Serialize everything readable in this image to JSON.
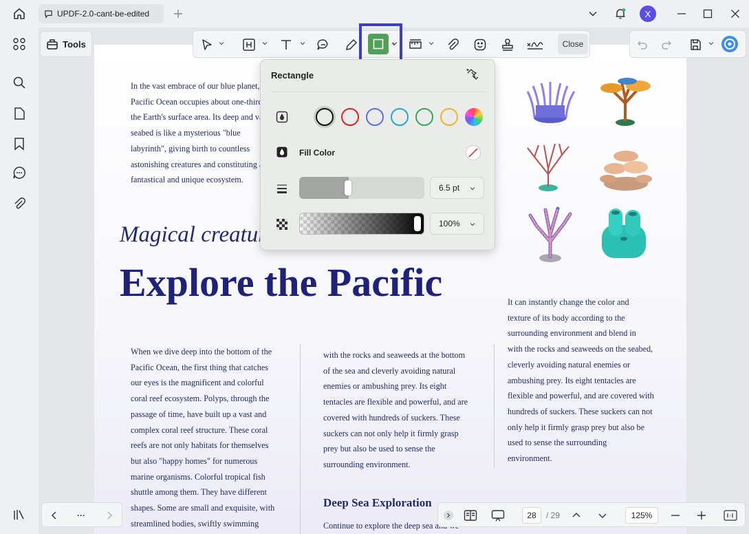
{
  "window": {
    "tab_title": "UPDF-2.0-cant-be-edited",
    "avatar_initial": "X"
  },
  "tools": {
    "label": "Tools"
  },
  "toolbar": {
    "close_label": "Close"
  },
  "popup": {
    "title": "Rectangle",
    "fill_color_label": "Fill Color",
    "stroke_colors": [
      "#111111",
      "#e0211f",
      "#5b6ee8",
      "#1fa7dc",
      "#3aa45a",
      "#f0b429",
      "rainbow"
    ],
    "selected_stroke": "#111111",
    "stroke_width": "6.5 pt",
    "opacity": "100%",
    "stroke_width_fraction": 0.36
  },
  "document": {
    "intro": "In the vast embrace of our blue planet, the\nPacific Ocean occupies about one-third of\nthe Earth's surface area. Its deep and vast\nseabed is like a mysterious \"blue\nlabyrinth\", giving birth to countless\nastonishing creatures and constituting a\nfantastical and unique ecosystem.",
    "subtitle": "Magical creatures",
    "title": "Explore the Pacific",
    "col1": "When we dive deep into the bottom of the\nPacific Ocean, the first thing that catches\nour eyes is the magnificent and colorful\ncoral reef ecosystem. Polyps, through the\npassage of time, have built up a vast and\ncomplex coral reef structure. These coral\nreefs are not only habitats for themselves\nbut also \"happy homes\" for numerous\nmarine organisms. Colorful tropical fish\nshuttle among them. They have different\nshapes. Some are small and exquisite, with\nstreamlined bodies, swiftly swimming",
    "col2": "with the rocks and seaweeds at the bottom\nof the sea and cleverly avoiding natural\nenemies or ambushing prey. Its eight\ntentacles are flexible and powerful, and are\ncovered with hundreds of suckers. These\nsuckers can not only help it firmly grasp\nprey but also be used to sense the\nsurrounding environment.",
    "col2_heading": "Deep Sea Exploration",
    "col2_tail": "Continue to explore the deep sea and we",
    "col3": "It can instantly change the color and\ntexture of its body according to the\nsurrounding environment and blend in\nwith the rocks and seaweeds on the seabed,\ncleverly avoiding natural enemies or\nambushing prey. Its eight tentacles are\nflexible and powerful, and are covered with\nhundreds of suckers. These suckers can not\nonly help it firmly grasp prey but also be\nused to sense the surrounding\nenvironment."
  },
  "pager": {
    "ellipsis": "···",
    "current_page": "28",
    "total_pages": "/ 29",
    "zoom": "125%"
  }
}
